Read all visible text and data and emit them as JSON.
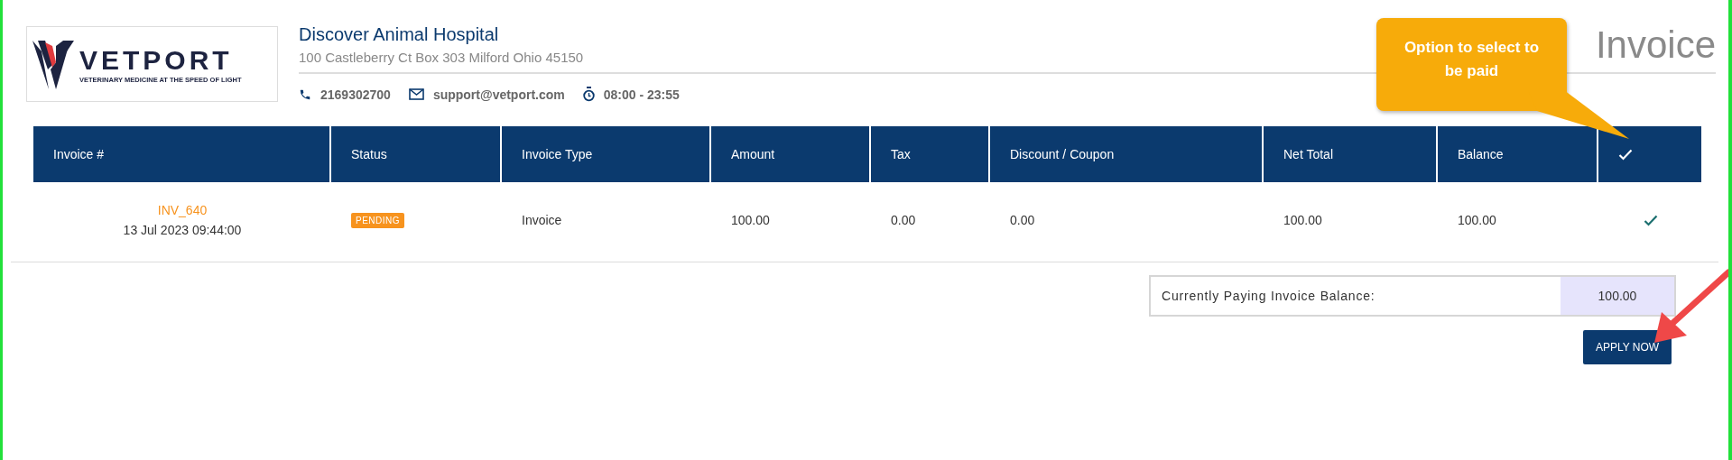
{
  "logo": {
    "name": "VETPORT",
    "tagline": "VETERINARY MEDICINE AT THE SPEED OF LIGHT"
  },
  "hospital": {
    "name": "Discover Animal Hospital",
    "address": "100 Castleberry Ct Box 303 Milford Ohio 45150",
    "phone": "2169302700",
    "email": "support@vetport.com",
    "hours": "08:00 - 23:55"
  },
  "page_title": "Invoice",
  "callout": "Option to select to be paid",
  "table": {
    "columns": [
      "Invoice #",
      "Status",
      "Invoice Type",
      "Amount",
      "Tax",
      "Discount / Coupon",
      "Net Total",
      "Balance"
    ],
    "rows": [
      {
        "invoice": "INV_640",
        "date": "13 Jul 2023 09:44:00",
        "status": "PENDING",
        "type": "Invoice",
        "amount": "100.00",
        "tax": "0.00",
        "discount": "0.00",
        "net_total": "100.00",
        "balance": "100.00",
        "selected": true
      }
    ]
  },
  "summary": {
    "label": "Currently Paying Invoice Balance:",
    "value": "100.00"
  },
  "apply_button": "APPLY NOW"
}
